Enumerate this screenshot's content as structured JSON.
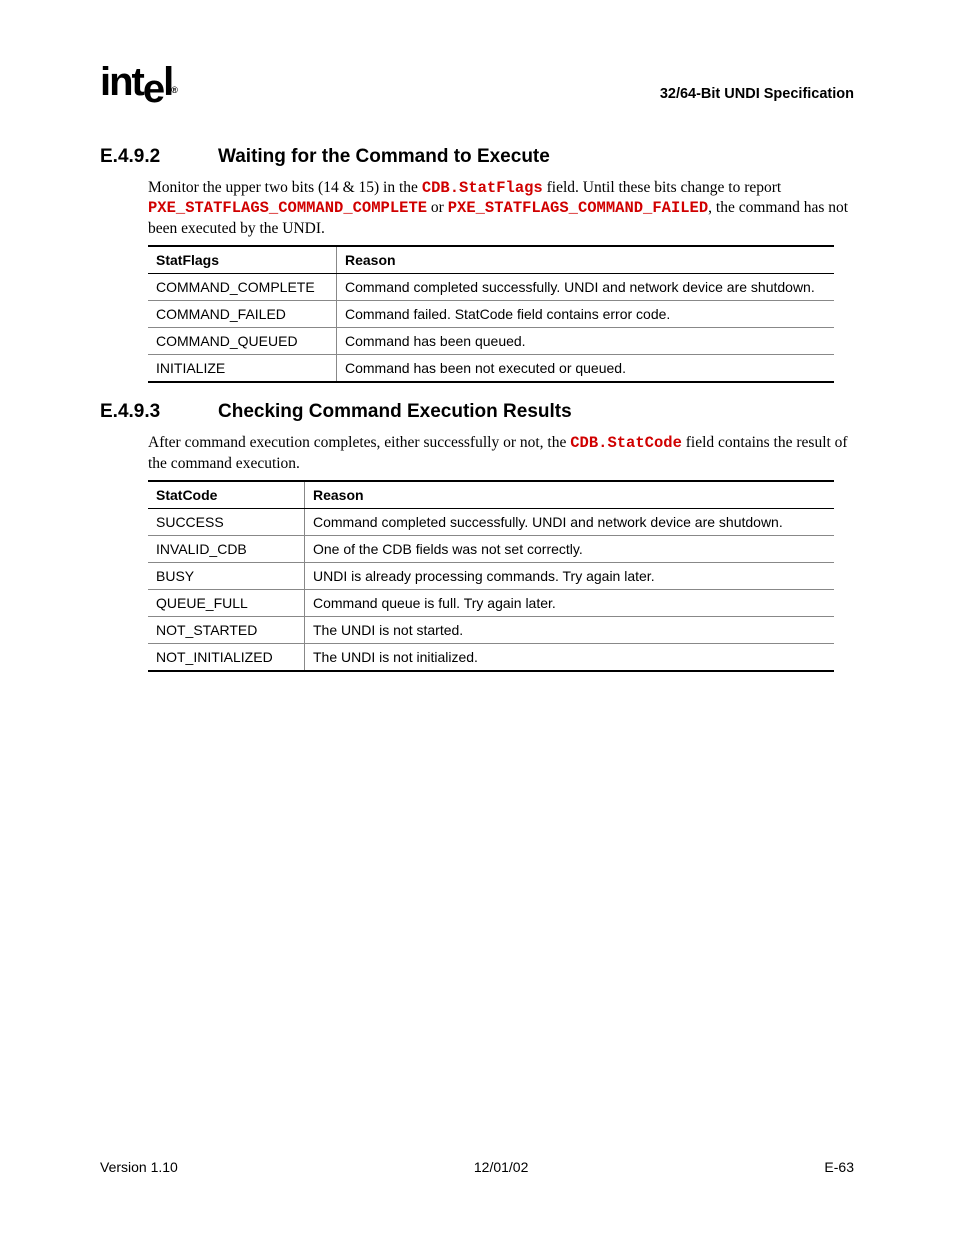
{
  "header": {
    "logo_text": "intel",
    "spec_title": "32/64-Bit UNDI Specification"
  },
  "section1": {
    "number": "E.4.9.2",
    "title": "Waiting for the Command to Execute",
    "para_pre": "Monitor the upper two bits (14 & 15) in the ",
    "code1": "CDB.StatFlags",
    "para_mid1": " field.  Until these bits change to report ",
    "code2": "PXE_STATFLAGS_COMMAND_COMPLETE",
    "para_mid2": " or ",
    "code3": "PXE_STATFLAGS_COMMAND_FAILED",
    "para_post": ", the command has not been executed by the UNDI.",
    "table": {
      "col1": "StatFlags",
      "col2": "Reason",
      "rows": [
        {
          "c1": "COMMAND_COMPLETE",
          "c2": "Command completed successfully.  UNDI and network device are shutdown."
        },
        {
          "c1": "COMMAND_FAILED",
          "c2": "Command failed.  StatCode field contains error code."
        },
        {
          "c1": "COMMAND_QUEUED",
          "c2": "Command has been queued."
        },
        {
          "c1": "INITIALIZE",
          "c2": "Command has been not executed or queued."
        }
      ]
    }
  },
  "section2": {
    "number": "E.4.9.3",
    "title": "Checking Command Execution Results",
    "para_pre": "After command execution completes, either successfully or not, the ",
    "code1": "CDB.StatCode",
    "para_post": " field contains the result of the command execution.",
    "table": {
      "col1": "StatCode",
      "col2": "Reason",
      "rows": [
        {
          "c1": "SUCCESS",
          "c2": "Command completed successfully.  UNDI and network device are shutdown."
        },
        {
          "c1": "INVALID_CDB",
          "c2": "One of the CDB fields was not set correctly."
        },
        {
          "c1": "BUSY",
          "c2": "UNDI is already processing commands.  Try again later."
        },
        {
          "c1": "QUEUE_FULL",
          "c2": "Command queue is full.  Try again later."
        },
        {
          "c1": "NOT_STARTED",
          "c2": "The UNDI is not started."
        },
        {
          "c1": "NOT_INITIALIZED",
          "c2": "The UNDI is not initialized."
        }
      ]
    }
  },
  "footer": {
    "left": "Version 1.10",
    "center": "12/01/02",
    "right": "E-63"
  }
}
